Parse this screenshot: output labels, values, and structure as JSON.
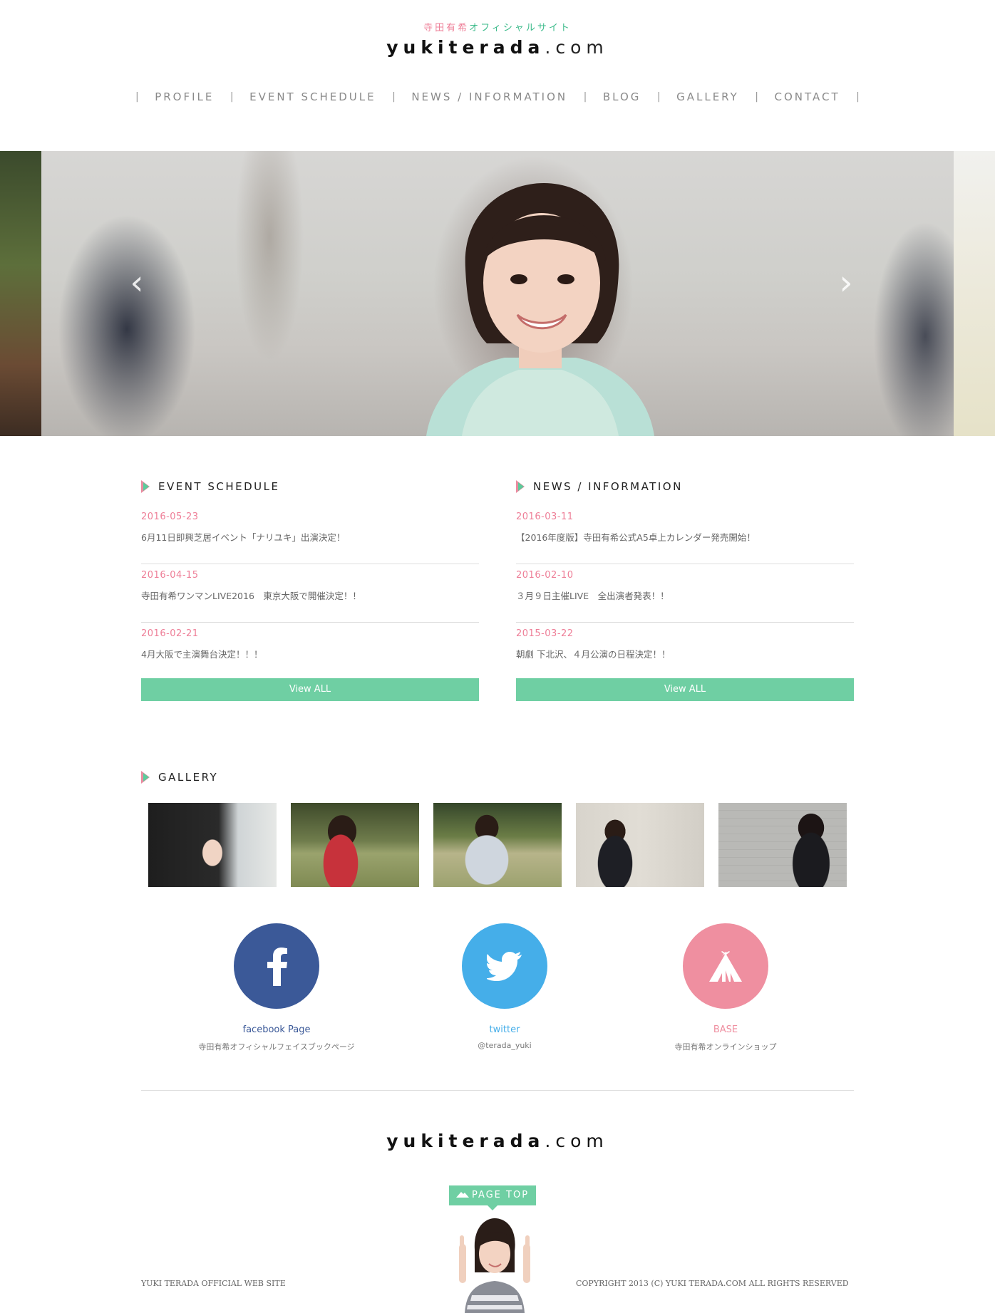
{
  "header": {
    "tagline_part1": "寺田有希",
    "tagline_part2": "オフィシャルサイト",
    "logo_bold": "yukiterada",
    "logo_domain": ".com"
  },
  "nav": {
    "separator": "|",
    "items": [
      {
        "label": "PROFILE"
      },
      {
        "label": "EVENT SCHEDULE"
      },
      {
        "label": "NEWS / INFORMATION"
      },
      {
        "label": "BLOG"
      },
      {
        "label": "GALLERY"
      },
      {
        "label": "CONTACT"
      }
    ]
  },
  "hero": {
    "prev_icon": "chevron-left-icon",
    "next_icon": "chevron-right-icon",
    "prev_glyph": "‹",
    "next_glyph": "›"
  },
  "events": {
    "heading": "EVENT SCHEDULE",
    "items": [
      {
        "date": "2016-05-23",
        "title": "6月11日即興芝居イベント「ナリユキ」出演決定！"
      },
      {
        "date": "2016-04-15",
        "title": "寺田有希ワンマンLIVE2016　東京大阪で開催決定！！"
      },
      {
        "date": "2016-02-21",
        "title": "4月大阪で主演舞台決定！！！"
      }
    ],
    "view_all": "View ALL"
  },
  "news": {
    "heading": "NEWS / INFORMATION",
    "items": [
      {
        "date": "2016-03-11",
        "title": "【2016年度版】寺田有希公式A5卓上カレンダー発売開始！"
      },
      {
        "date": "2016-02-10",
        "title": "３月９日主催LIVE　全出演者発表！！"
      },
      {
        "date": "2015-03-22",
        "title": "朝劇 下北沢、４月公演の日程決定！！"
      }
    ],
    "view_all": "View ALL"
  },
  "gallery": {
    "heading": "GALLERY"
  },
  "social": {
    "facebook": {
      "name": "facebook Page",
      "sub": "寺田有希オフィシャルフェイスブックページ",
      "color": "#3b5998",
      "icon": "facebook-icon"
    },
    "twitter": {
      "name": "twitter",
      "sub": "@terada_yuki",
      "color": "#45aee9",
      "icon": "twitter-bird-icon"
    },
    "base": {
      "name": "BASE",
      "sub": "寺田有希オンラインショップ",
      "color": "#ef8fa0",
      "icon": "tent-icon"
    }
  },
  "footer": {
    "logo_bold": "yukiterada",
    "logo_domain": ".com",
    "page_top": "PAGE TOP",
    "left": "YUKI TERADA OFFICIAL WEB SITE",
    "right": "COPYRIGHT 2013 (C) YUKI TERADA.COM ALL RIGHTS RESERVED"
  },
  "colors": {
    "accent_pink": "#ee7e97",
    "accent_green": "#6fcfa3"
  }
}
